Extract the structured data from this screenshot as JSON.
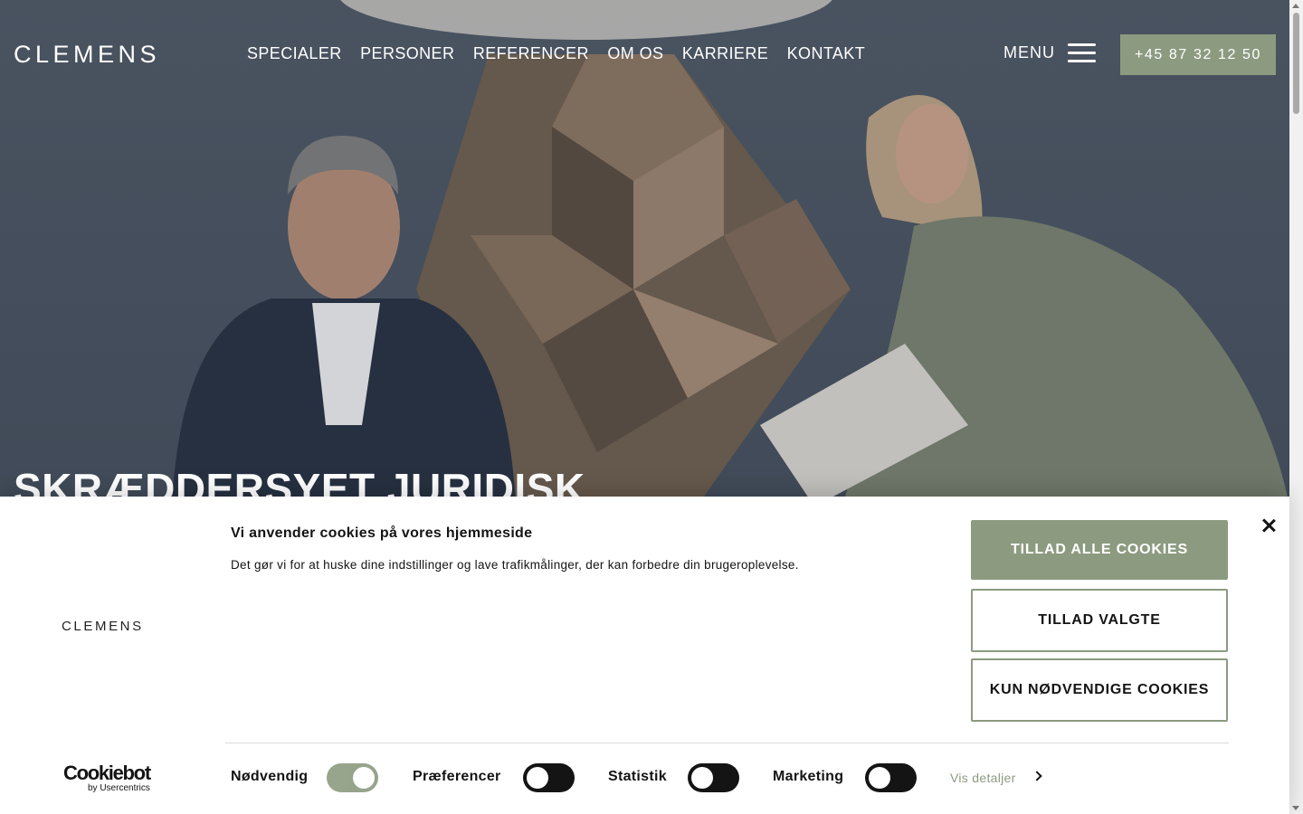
{
  "header": {
    "logo": "CLEMENS",
    "nav": [
      "SPECIALER",
      "PERSONER",
      "REFERENCER",
      "OM OS",
      "KARRIERE",
      "KONTAKT"
    ],
    "menu_label": "MENU",
    "phone": "+45 87 32 12 50"
  },
  "hero": {
    "title": "SKRÆDDERSYET JURIDISK"
  },
  "cookie_banner": {
    "logo": "CLEMENS",
    "brand_main": "Cookiebot",
    "brand_sub": "by Usercentrics",
    "title": "Vi anvender cookies på vores hjemmeside",
    "text": "Det gør vi for at huske dine indstillinger og lave trafikmålinger, der kan forbedre din brugeroplevelse.",
    "buttons": {
      "allow_all": "TILLAD ALLE COOKIES",
      "allow_selected": "TILLAD VALGTE",
      "necessary_only": "KUN NØDVENDIGE COOKIES"
    },
    "toggles": [
      {
        "label": "Nødvendig",
        "on": true
      },
      {
        "label": "Præferencer",
        "on": false
      },
      {
        "label": "Statistik",
        "on": false
      },
      {
        "label": "Marketing",
        "on": false
      }
    ],
    "details_link": "Vis detaljer"
  },
  "colors": {
    "accent": "#8c9b80",
    "hero_bg": "#4b5562",
    "text_dark": "#141414"
  }
}
